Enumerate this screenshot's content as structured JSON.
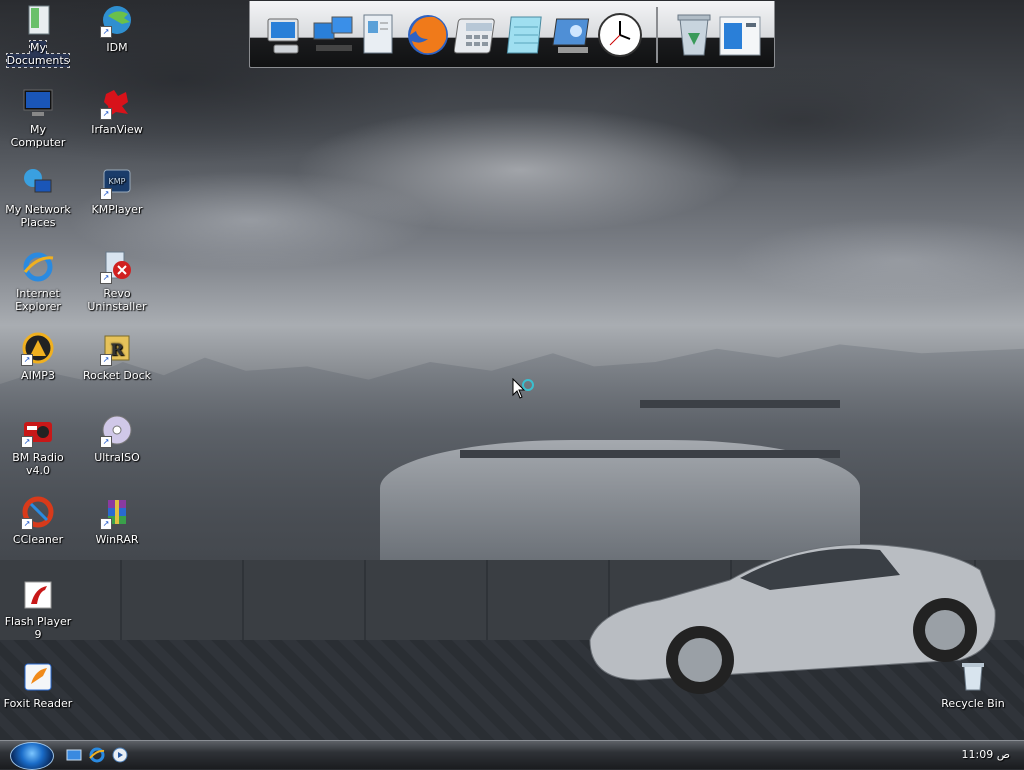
{
  "desktop": {
    "icons": [
      {
        "label": "My Documents"
      },
      {
        "label": "IDM"
      },
      {
        "label": "My Computer"
      },
      {
        "label": "IrfanView"
      },
      {
        "label": "My Network Places"
      },
      {
        "label": "KMPlayer"
      },
      {
        "label": "Internet Explorer"
      },
      {
        "label": "Revo Uninstaller"
      },
      {
        "label": "AIMP3"
      },
      {
        "label": "Rocket Dock"
      },
      {
        "label": "BM Radio v4.0"
      },
      {
        "label": "UltraISO"
      },
      {
        "label": "CCleaner"
      },
      {
        "label": "WinRAR"
      },
      {
        "label": "Flash Player 9"
      },
      {
        "label": "Foxit Reader"
      },
      {
        "label": "Recycle Bin"
      }
    ]
  },
  "dock": {
    "items": [
      "my-computer-icon",
      "network-icon",
      "documents-icon",
      "firefox-icon",
      "calculator-icon",
      "notepad-icon",
      "control-panel-icon",
      "clock-icon",
      "recycle-bin-icon",
      "show-desktop-icon"
    ]
  },
  "taskbar": {
    "clock": "ص 11:09",
    "quick_launch": [
      "show-desktop-icon",
      "internet-explorer-icon",
      "media-player-icon"
    ]
  },
  "colors": {
    "accent": "#1a6cc8",
    "taskbar": "#1a1c1f"
  }
}
